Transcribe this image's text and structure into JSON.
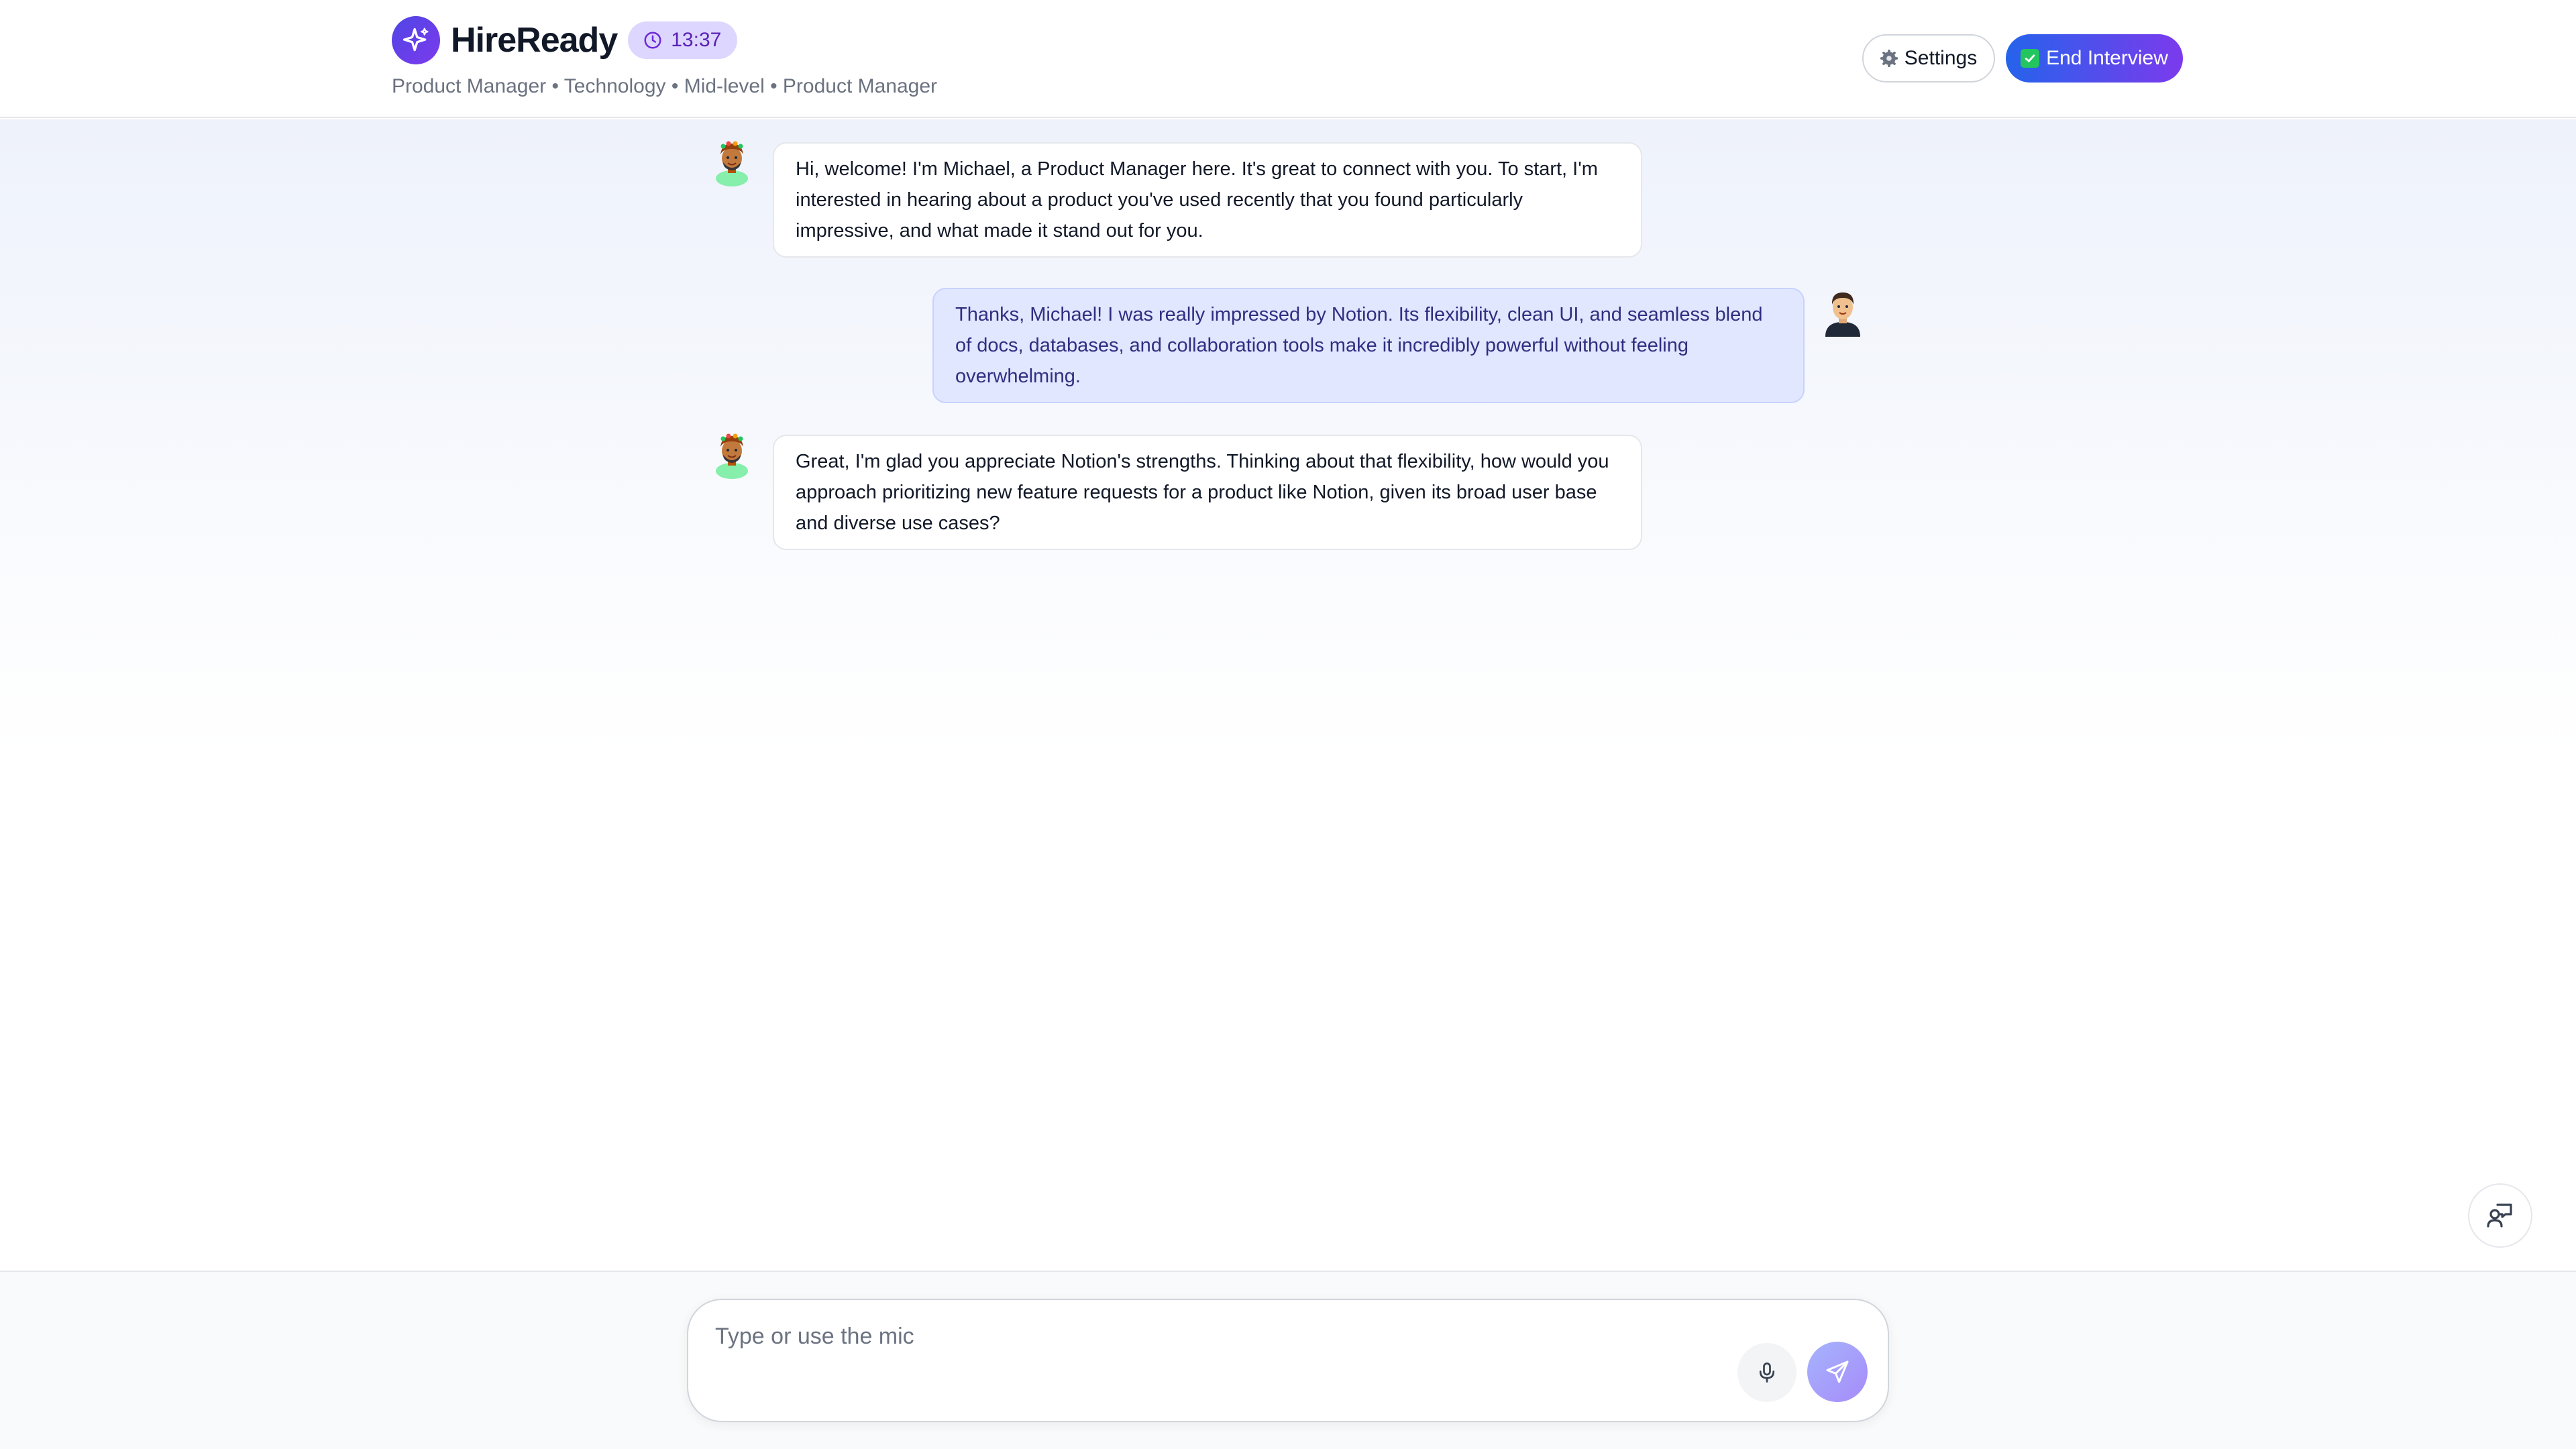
{
  "header": {
    "brand_name": "HireReady",
    "logo_icon": "sparkle-icon",
    "timer": "13:37",
    "subtitle": "Product Manager • Technology • Mid-level • Product Manager",
    "settings_label": "Settings",
    "end_interview_label": "End Interview"
  },
  "messages": [
    {
      "role": "interviewer",
      "avatar": "interviewer-avatar",
      "text": "Hi, welcome! I'm Michael, a Product Manager here. It's great to connect with you. To start, I'm interested in hearing about a product you've used recently that you found particularly impressive, and what made it stand out for you."
    },
    {
      "role": "candidate",
      "avatar": "user-avatar",
      "text": "Thanks, Michael! I was really impressed by Notion. Its flexibility, clean UI, and seamless blend of docs, databases, and collaboration tools make it incredibly powerful without feeling overwhelming."
    },
    {
      "role": "interviewer",
      "avatar": "interviewer-avatar",
      "text": "Great, I'm glad you appreciate Notion's strengths. Thinking about that flexibility, how would you approach prioritizing new feature requests for a product like Notion, given its broad user base and diverse use cases?"
    }
  ],
  "composer": {
    "placeholder": "Type or use the mic",
    "value": ""
  },
  "colors": {
    "accent": "#4f46e5",
    "accent_secondary": "#7c3aed",
    "user_bubble": "#e0e7ff",
    "timer_bg": "#ddd6fe"
  }
}
